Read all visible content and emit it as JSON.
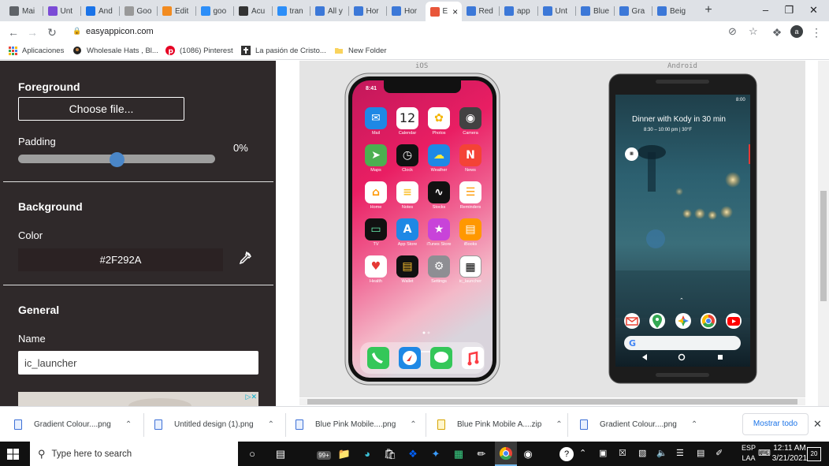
{
  "browser": {
    "tabs": [
      {
        "label": "Mai",
        "icon": "gmail-icon",
        "color": "#5f6368"
      },
      {
        "label": "Unt",
        "icon": "purple-doc-icon",
        "color": "#7b4bd6"
      },
      {
        "label": "And",
        "icon": "android-icon",
        "color": "#1a73e8"
      },
      {
        "label": "Goo",
        "icon": "google-icon",
        "color": "#999999"
      },
      {
        "label": "Edit",
        "icon": "edit-icon",
        "color": "#f28b20"
      },
      {
        "label": "goo",
        "icon": "bing-icon",
        "color": "#2c8ef8"
      },
      {
        "label": "Acu",
        "icon": "s-icon",
        "color": "#333333"
      },
      {
        "label": "tran",
        "icon": "bing-icon",
        "color": "#2c8ef8"
      },
      {
        "label": "All y",
        "icon": "chrome-ext-icon",
        "color": "#3c78d8"
      },
      {
        "label": "Hor",
        "icon": "chrome-ext-icon",
        "color": "#3c78d8"
      },
      {
        "label": "Hor",
        "icon": "chrome-ext-icon",
        "color": "#3c78d8"
      },
      {
        "label": "E",
        "icon": "easyappicon-icon",
        "color": "#e8563a",
        "active": true
      },
      {
        "label": "Red",
        "icon": "chrome-ext-icon",
        "color": "#3c78d8"
      },
      {
        "label": "app",
        "icon": "chrome-ext-icon",
        "color": "#3c78d8"
      },
      {
        "label": "Unt",
        "icon": "chrome-ext-icon",
        "color": "#3c78d8"
      },
      {
        "label": "Blue",
        "icon": "chrome-ext-icon",
        "color": "#3c78d8"
      },
      {
        "label": "Gra",
        "icon": "chrome-ext-icon",
        "color": "#3c78d8"
      },
      {
        "label": "Beig",
        "icon": "chrome-ext-icon",
        "color": "#3c78d8"
      }
    ],
    "url": "easyappicon.com",
    "avatar_letter": "a",
    "bookmarks": [
      {
        "label": "Aplicaciones",
        "icon": "apps-grid-icon"
      },
      {
        "label": "Wholesale Hats , Bl...",
        "icon": "hat-icon"
      },
      {
        "label": "(1086) Pinterest",
        "icon": "pinterest-icon"
      },
      {
        "label": "La pasión de Cristo...",
        "icon": "cross-icon"
      },
      {
        "label": "New Folder",
        "icon": "folder-icon"
      }
    ]
  },
  "panel": {
    "foreground_heading": "Foreground",
    "choose_file_label": "Choose file...",
    "padding_label": "Padding",
    "padding_value": "0%",
    "padding_fraction": 0.5,
    "background_heading": "Background",
    "color_label": "Color",
    "color_value": "#2F292A",
    "general_heading": "General",
    "name_label": "Name",
    "name_value": "ic_launcher",
    "panel_bg": "#2f292a",
    "slider_knob_color": "#4a86c8"
  },
  "preview": {
    "ios_label": "iOS",
    "android_label": "Android",
    "ios": {
      "time": "8:41",
      "calendar_day": "12",
      "apps": [
        "Mail",
        "Calendar",
        "Photos",
        "Camera",
        "Maps",
        "Clock",
        "Weather",
        "News",
        "Home",
        "Notes",
        "Stocks",
        "Reminders",
        "TV",
        "App Store",
        "iTunes Store",
        "iBooks",
        "Health",
        "Wallet",
        "Settings",
        "ic_launcher"
      ]
    },
    "android": {
      "time": "8:00",
      "event_title": "Dinner with Kody in 30 min",
      "event_detail": "8:30 – 10:00 pm  |  30°F"
    }
  },
  "downloads": {
    "items": [
      "Gradient Colour....png",
      "Untitled design (1).png",
      "Blue Pink Mobile....png",
      "Blue Pink Mobile A....zip",
      "Gradient Colour....png"
    ],
    "show_all": "Mostrar todo"
  },
  "taskbar": {
    "search_placeholder": "Type here to search",
    "badge_count": "99+",
    "lang_line1": "ESP",
    "lang_line2": "LAA",
    "time": "12:11 AM",
    "date": "3/21/2021",
    "notifications": "20"
  }
}
